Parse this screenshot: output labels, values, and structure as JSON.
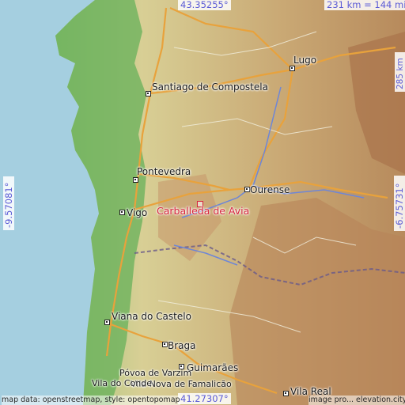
{
  "map": {
    "place": "Carballeda de Avia",
    "top_lat": "43.35255°",
    "bottom_lat": "41.27307°",
    "left_lon": "-9.57081°",
    "right_lon": "-6.75731°",
    "scale": "231 km = 144 mi",
    "elev_note": "285 km",
    "credit_left": "map data: openstreetmap, style: opentopomap",
    "credit_right": "image pro... elevation.city"
  },
  "cities": [
    {
      "name": "Lugo",
      "key": "lugo"
    },
    {
      "name": "Santiago de Compostela",
      "key": "santiago"
    },
    {
      "name": "Pontevedra",
      "key": "pontevedra"
    },
    {
      "name": "Ourense",
      "key": "ourense"
    },
    {
      "name": "Vigo",
      "key": "vigo"
    },
    {
      "name": "Viana do Castelo",
      "key": "viana"
    },
    {
      "name": "Braga",
      "key": "braga"
    },
    {
      "name": "Guimarães",
      "key": "guimaraes"
    },
    {
      "name": "Póvoa de Varzim",
      "key": "povoa"
    },
    {
      "name": "Vila Nova de Famalicão",
      "key": "famalicao"
    },
    {
      "name": "Vila do Conde",
      "key": "viladoconde"
    },
    {
      "name": "Vila Real",
      "key": "vilareal"
    }
  ]
}
